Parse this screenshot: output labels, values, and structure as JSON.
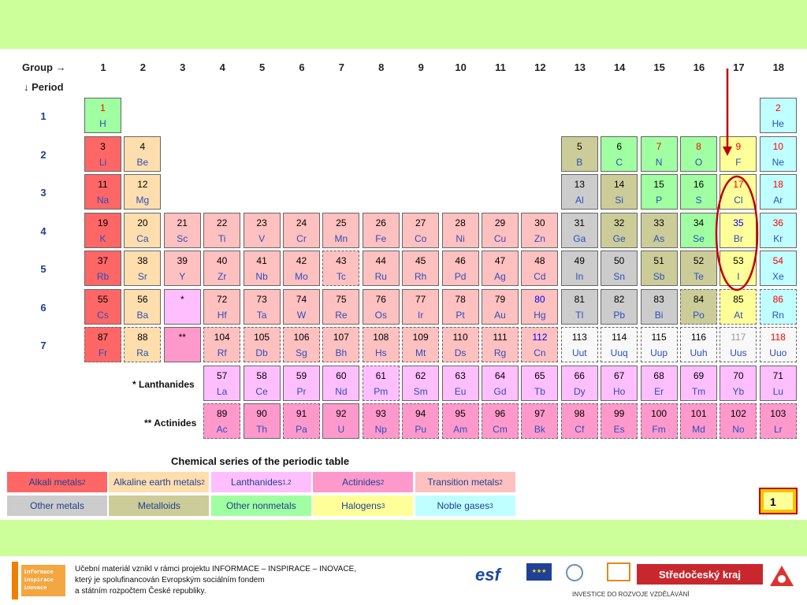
{
  "header": {
    "group_label": "Group →",
    "period_label": "↓ Period"
  },
  "groups": [
    "1",
    "2",
    "3",
    "4",
    "5",
    "6",
    "7",
    "8",
    "9",
    "10",
    "11",
    "12",
    "13",
    "14",
    "15",
    "16",
    "17",
    "18"
  ],
  "periods": [
    "1",
    "2",
    "3",
    "4",
    "5",
    "6",
    "7"
  ],
  "colors": {
    "alkali": "#ff6666",
    "alkaline": "#ffdead",
    "lanthanide": "#ffbfff",
    "actinide": "#ff99cc",
    "transition": "#ffc0c0",
    "other_metal": "#cccccc",
    "metalloid": "#cccc99",
    "nonmetal": "#a0ffa0",
    "halogen": "#ffff99",
    "noble": "#c0ffff",
    "unknown": "#f8f8f8",
    "number_red": "#ff0000",
    "number_blue": "#0000ff",
    "number_gray": "#999999",
    "number_black": "#000000",
    "top_band": "#ccff99",
    "marker": "#c00000"
  },
  "elements": [
    {
      "n": "1",
      "s": "H",
      "g": 1,
      "p": 1,
      "c": "nonmetal",
      "nc": "number_red"
    },
    {
      "n": "2",
      "s": "He",
      "g": 18,
      "p": 1,
      "c": "noble",
      "nc": "number_red"
    },
    {
      "n": "3",
      "s": "Li",
      "g": 1,
      "p": 2,
      "c": "alkali",
      "nc": "number_black"
    },
    {
      "n": "4",
      "s": "Be",
      "g": 2,
      "p": 2,
      "c": "alkaline",
      "nc": "number_black"
    },
    {
      "n": "5",
      "s": "B",
      "g": 13,
      "p": 2,
      "c": "metalloid",
      "nc": "number_black"
    },
    {
      "n": "6",
      "s": "C",
      "g": 14,
      "p": 2,
      "c": "nonmetal",
      "nc": "number_black"
    },
    {
      "n": "7",
      "s": "N",
      "g": 15,
      "p": 2,
      "c": "nonmetal",
      "nc": "number_red"
    },
    {
      "n": "8",
      "s": "O",
      "g": 16,
      "p": 2,
      "c": "nonmetal",
      "nc": "number_red"
    },
    {
      "n": "9",
      "s": "F",
      "g": 17,
      "p": 2,
      "c": "halogen",
      "nc": "number_red"
    },
    {
      "n": "10",
      "s": "Ne",
      "g": 18,
      "p": 2,
      "c": "noble",
      "nc": "number_red"
    },
    {
      "n": "11",
      "s": "Na",
      "g": 1,
      "p": 3,
      "c": "alkali",
      "nc": "number_black"
    },
    {
      "n": "12",
      "s": "Mg",
      "g": 2,
      "p": 3,
      "c": "alkaline",
      "nc": "number_black"
    },
    {
      "n": "13",
      "s": "Al",
      "g": 13,
      "p": 3,
      "c": "other_metal",
      "nc": "number_black"
    },
    {
      "n": "14",
      "s": "Si",
      "g": 14,
      "p": 3,
      "c": "metalloid",
      "nc": "number_black"
    },
    {
      "n": "15",
      "s": "P",
      "g": 15,
      "p": 3,
      "c": "nonmetal",
      "nc": "number_black"
    },
    {
      "n": "16",
      "s": "S",
      "g": 16,
      "p": 3,
      "c": "nonmetal",
      "nc": "number_black"
    },
    {
      "n": "17",
      "s": "Cl",
      "g": 17,
      "p": 3,
      "c": "halogen",
      "nc": "number_red"
    },
    {
      "n": "18",
      "s": "Ar",
      "g": 18,
      "p": 3,
      "c": "noble",
      "nc": "number_red"
    },
    {
      "n": "19",
      "s": "K",
      "g": 1,
      "p": 4,
      "c": "alkali",
      "nc": "number_black"
    },
    {
      "n": "20",
      "s": "Ca",
      "g": 2,
      "p": 4,
      "c": "alkaline",
      "nc": "number_black"
    },
    {
      "n": "21",
      "s": "Sc",
      "g": 3,
      "p": 4,
      "c": "transition",
      "nc": "number_black"
    },
    {
      "n": "22",
      "s": "Ti",
      "g": 4,
      "p": 4,
      "c": "transition",
      "nc": "number_black"
    },
    {
      "n": "23",
      "s": "V",
      "g": 5,
      "p": 4,
      "c": "transition",
      "nc": "number_black"
    },
    {
      "n": "24",
      "s": "Cr",
      "g": 6,
      "p": 4,
      "c": "transition",
      "nc": "number_black"
    },
    {
      "n": "25",
      "s": "Mn",
      "g": 7,
      "p": 4,
      "c": "transition",
      "nc": "number_black"
    },
    {
      "n": "26",
      "s": "Fe",
      "g": 8,
      "p": 4,
      "c": "transition",
      "nc": "number_black"
    },
    {
      "n": "27",
      "s": "Co",
      "g": 9,
      "p": 4,
      "c": "transition",
      "nc": "number_black"
    },
    {
      "n": "28",
      "s": "Ni",
      "g": 10,
      "p": 4,
      "c": "transition",
      "nc": "number_black"
    },
    {
      "n": "29",
      "s": "Cu",
      "g": 11,
      "p": 4,
      "c": "transition",
      "nc": "number_black"
    },
    {
      "n": "30",
      "s": "Zn",
      "g": 12,
      "p": 4,
      "c": "transition",
      "nc": "number_black"
    },
    {
      "n": "31",
      "s": "Ga",
      "g": 13,
      "p": 4,
      "c": "other_metal",
      "nc": "number_black"
    },
    {
      "n": "32",
      "s": "Ge",
      "g": 14,
      "p": 4,
      "c": "metalloid",
      "nc": "number_black"
    },
    {
      "n": "33",
      "s": "As",
      "g": 15,
      "p": 4,
      "c": "metalloid",
      "nc": "number_black"
    },
    {
      "n": "34",
      "s": "Se",
      "g": 16,
      "p": 4,
      "c": "nonmetal",
      "nc": "number_black"
    },
    {
      "n": "35",
      "s": "Br",
      "g": 17,
      "p": 4,
      "c": "halogen",
      "nc": "number_blue"
    },
    {
      "n": "36",
      "s": "Kr",
      "g": 18,
      "p": 4,
      "c": "noble",
      "nc": "number_red"
    },
    {
      "n": "37",
      "s": "Rb",
      "g": 1,
      "p": 5,
      "c": "alkali",
      "nc": "number_black"
    },
    {
      "n": "38",
      "s": "Sr",
      "g": 2,
      "p": 5,
      "c": "alkaline",
      "nc": "number_black"
    },
    {
      "n": "39",
      "s": "Y",
      "g": 3,
      "p": 5,
      "c": "transition",
      "nc": "number_black"
    },
    {
      "n": "40",
      "s": "Zr",
      "g": 4,
      "p": 5,
      "c": "transition",
      "nc": "number_black"
    },
    {
      "n": "41",
      "s": "Nb",
      "g": 5,
      "p": 5,
      "c": "transition",
      "nc": "number_black"
    },
    {
      "n": "42",
      "s": "Mo",
      "g": 6,
      "p": 5,
      "c": "transition",
      "nc": "number_black"
    },
    {
      "n": "43",
      "s": "Tc",
      "g": 7,
      "p": 5,
      "c": "transition",
      "nc": "number_black",
      "d": true
    },
    {
      "n": "44",
      "s": "Ru",
      "g": 8,
      "p": 5,
      "c": "transition",
      "nc": "number_black"
    },
    {
      "n": "45",
      "s": "Rh",
      "g": 9,
      "p": 5,
      "c": "transition",
      "nc": "number_black"
    },
    {
      "n": "46",
      "s": "Pd",
      "g": 10,
      "p": 5,
      "c": "transition",
      "nc": "number_black"
    },
    {
      "n": "47",
      "s": "Ag",
      "g": 11,
      "p": 5,
      "c": "transition",
      "nc": "number_black"
    },
    {
      "n": "48",
      "s": "Cd",
      "g": 12,
      "p": 5,
      "c": "transition",
      "nc": "number_black"
    },
    {
      "n": "49",
      "s": "In",
      "g": 13,
      "p": 5,
      "c": "other_metal",
      "nc": "number_black"
    },
    {
      "n": "50",
      "s": "Sn",
      "g": 14,
      "p": 5,
      "c": "other_metal",
      "nc": "number_black"
    },
    {
      "n": "51",
      "s": "Sb",
      "g": 15,
      "p": 5,
      "c": "metalloid",
      "nc": "number_black"
    },
    {
      "n": "52",
      "s": "Te",
      "g": 16,
      "p": 5,
      "c": "metalloid",
      "nc": "number_black"
    },
    {
      "n": "53",
      "s": "I",
      "g": 17,
      "p": 5,
      "c": "halogen",
      "nc": "number_black"
    },
    {
      "n": "54",
      "s": "Xe",
      "g": 18,
      "p": 5,
      "c": "noble",
      "nc": "number_red"
    },
    {
      "n": "55",
      "s": "Cs",
      "g": 1,
      "p": 6,
      "c": "alkali",
      "nc": "number_black"
    },
    {
      "n": "56",
      "s": "Ba",
      "g": 2,
      "p": 6,
      "c": "alkaline",
      "nc": "number_black"
    },
    {
      "n": "*",
      "s": "",
      "g": 3,
      "p": 6,
      "c": "lanthanide",
      "nc": "number_black",
      "nb": true
    },
    {
      "n": "72",
      "s": "Hf",
      "g": 4,
      "p": 6,
      "c": "transition",
      "nc": "number_black"
    },
    {
      "n": "73",
      "s": "Ta",
      "g": 5,
      "p": 6,
      "c": "transition",
      "nc": "number_black"
    },
    {
      "n": "74",
      "s": "W",
      "g": 6,
      "p": 6,
      "c": "transition",
      "nc": "number_black"
    },
    {
      "n": "75",
      "s": "Re",
      "g": 7,
      "p": 6,
      "c": "transition",
      "nc": "number_black"
    },
    {
      "n": "76",
      "s": "Os",
      "g": 8,
      "p": 6,
      "c": "transition",
      "nc": "number_black"
    },
    {
      "n": "77",
      "s": "Ir",
      "g": 9,
      "p": 6,
      "c": "transition",
      "nc": "number_black"
    },
    {
      "n": "78",
      "s": "Pt",
      "g": 10,
      "p": 6,
      "c": "transition",
      "nc": "number_black"
    },
    {
      "n": "79",
      "s": "Au",
      "g": 11,
      "p": 6,
      "c": "transition",
      "nc": "number_black"
    },
    {
      "n": "80",
      "s": "Hg",
      "g": 12,
      "p": 6,
      "c": "transition",
      "nc": "number_blue"
    },
    {
      "n": "81",
      "s": "Tl",
      "g": 13,
      "p": 6,
      "c": "other_metal",
      "nc": "number_black"
    },
    {
      "n": "82",
      "s": "Pb",
      "g": 14,
      "p": 6,
      "c": "other_metal",
      "nc": "number_black"
    },
    {
      "n": "83",
      "s": "Bi",
      "g": 15,
      "p": 6,
      "c": "other_metal",
      "nc": "number_black"
    },
    {
      "n": "84",
      "s": "Po",
      "g": 16,
      "p": 6,
      "c": "metalloid",
      "nc": "number_black",
      "d": true
    },
    {
      "n": "85",
      "s": "At",
      "g": 17,
      "p": 6,
      "c": "halogen",
      "nc": "number_black",
      "d": true
    },
    {
      "n": "86",
      "s": "Rn",
      "g": 18,
      "p": 6,
      "c": "noble",
      "nc": "number_red",
      "d": true
    },
    {
      "n": "87",
      "s": "Fr",
      "g": 1,
      "p": 7,
      "c": "alkali",
      "nc": "number_black",
      "d": true
    },
    {
      "n": "88",
      "s": "Ra",
      "g": 2,
      "p": 7,
      "c": "alkaline",
      "nc": "number_black",
      "d": true
    },
    {
      "n": "**",
      "s": "",
      "g": 3,
      "p": 7,
      "c": "actinide",
      "nc": "number_black",
      "nb": true
    },
    {
      "n": "104",
      "s": "Rf",
      "g": 4,
      "p": 7,
      "c": "transition",
      "nc": "number_black",
      "d": true
    },
    {
      "n": "105",
      "s": "Db",
      "g": 5,
      "p": 7,
      "c": "transition",
      "nc": "number_black",
      "d": true
    },
    {
      "n": "106",
      "s": "Sg",
      "g": 6,
      "p": 7,
      "c": "transition",
      "nc": "number_black",
      "d": true
    },
    {
      "n": "107",
      "s": "Bh",
      "g": 7,
      "p": 7,
      "c": "transition",
      "nc": "number_black",
      "d": true
    },
    {
      "n": "108",
      "s": "Hs",
      "g": 8,
      "p": 7,
      "c": "transition",
      "nc": "number_black",
      "d": true
    },
    {
      "n": "109",
      "s": "Mt",
      "g": 9,
      "p": 7,
      "c": "transition",
      "nc": "number_black",
      "d": true
    },
    {
      "n": "110",
      "s": "Ds",
      "g": 10,
      "p": 7,
      "c": "transition",
      "nc": "number_black",
      "d": true
    },
    {
      "n": "111",
      "s": "Rg",
      "g": 11,
      "p": 7,
      "c": "transition",
      "nc": "number_black",
      "d": true
    },
    {
      "n": "112",
      "s": "Cn",
      "g": 12,
      "p": 7,
      "c": "transition",
      "nc": "number_blue",
      "d": true
    },
    {
      "n": "113",
      "s": "Uut",
      "g": 13,
      "p": 7,
      "c": "unknown",
      "nc": "number_black",
      "d": true
    },
    {
      "n": "114",
      "s": "Uuq",
      "g": 14,
      "p": 7,
      "c": "unknown",
      "nc": "number_black",
      "d": true
    },
    {
      "n": "115",
      "s": "Uup",
      "g": 15,
      "p": 7,
      "c": "unknown",
      "nc": "number_black",
      "d": true
    },
    {
      "n": "116",
      "s": "Uuh",
      "g": 16,
      "p": 7,
      "c": "unknown",
      "nc": "number_black",
      "d": true
    },
    {
      "n": "117",
      "s": "Uus",
      "g": 17,
      "p": 7,
      "c": "unknown",
      "nc": "number_gray",
      "d": true
    },
    {
      "n": "118",
      "s": "Uuo",
      "g": 18,
      "p": 7,
      "c": "unknown",
      "nc": "number_red",
      "d": true
    },
    {
      "n": "57",
      "s": "La",
      "g": 4,
      "p": 8,
      "c": "lanthanide",
      "nc": "number_black"
    },
    {
      "n": "58",
      "s": "Ce",
      "g": 5,
      "p": 8,
      "c": "lanthanide",
      "nc": "number_black"
    },
    {
      "n": "59",
      "s": "Pr",
      "g": 6,
      "p": 8,
      "c": "lanthanide",
      "nc": "number_black"
    },
    {
      "n": "60",
      "s": "Nd",
      "g": 7,
      "p": 8,
      "c": "lanthanide",
      "nc": "number_black"
    },
    {
      "n": "61",
      "s": "Pm",
      "g": 8,
      "p": 8,
      "c": "lanthanide",
      "nc": "number_black",
      "d": true
    },
    {
      "n": "62",
      "s": "Sm",
      "g": 9,
      "p": 8,
      "c": "lanthanide",
      "nc": "number_black"
    },
    {
      "n": "63",
      "s": "Eu",
      "g": 10,
      "p": 8,
      "c": "lanthanide",
      "nc": "number_black"
    },
    {
      "n": "64",
      "s": "Gd",
      "g": 11,
      "p": 8,
      "c": "lanthanide",
      "nc": "number_black"
    },
    {
      "n": "65",
      "s": "Tb",
      "g": 12,
      "p": 8,
      "c": "lanthanide",
      "nc": "number_black"
    },
    {
      "n": "66",
      "s": "Dy",
      "g": 13,
      "p": 8,
      "c": "lanthanide",
      "nc": "number_black"
    },
    {
      "n": "67",
      "s": "Ho",
      "g": 14,
      "p": 8,
      "c": "lanthanide",
      "nc": "number_black"
    },
    {
      "n": "68",
      "s": "Er",
      "g": 15,
      "p": 8,
      "c": "lanthanide",
      "nc": "number_black"
    },
    {
      "n": "69",
      "s": "Tm",
      "g": 16,
      "p": 8,
      "c": "lanthanide",
      "nc": "number_black"
    },
    {
      "n": "70",
      "s": "Yb",
      "g": 17,
      "p": 8,
      "c": "lanthanide",
      "nc": "number_black"
    },
    {
      "n": "71",
      "s": "Lu",
      "g": 18,
      "p": 8,
      "c": "lanthanide",
      "nc": "number_black"
    },
    {
      "n": "89",
      "s": "Ac",
      "g": 4,
      "p": 9,
      "c": "actinide",
      "nc": "number_black",
      "d": true
    },
    {
      "n": "90",
      "s": "Th",
      "g": 5,
      "p": 9,
      "c": "actinide",
      "nc": "number_black"
    },
    {
      "n": "91",
      "s": "Pa",
      "g": 6,
      "p": 9,
      "c": "actinide",
      "nc": "number_black",
      "d": true
    },
    {
      "n": "92",
      "s": "U",
      "g": 7,
      "p": 9,
      "c": "actinide",
      "nc": "number_black"
    },
    {
      "n": "93",
      "s": "Np",
      "g": 8,
      "p": 9,
      "c": "actinide",
      "nc": "number_black",
      "d": true
    },
    {
      "n": "94",
      "s": "Pu",
      "g": 9,
      "p": 9,
      "c": "actinide",
      "nc": "number_black",
      "d": true
    },
    {
      "n": "95",
      "s": "Am",
      "g": 10,
      "p": 9,
      "c": "actinide",
      "nc": "number_black",
      "d": true
    },
    {
      "n": "96",
      "s": "Cm",
      "g": 11,
      "p": 9,
      "c": "actinide",
      "nc": "number_black",
      "d": true
    },
    {
      "n": "97",
      "s": "Bk",
      "g": 12,
      "p": 9,
      "c": "actinide",
      "nc": "number_black",
      "d": true
    },
    {
      "n": "98",
      "s": "Cf",
      "g": 13,
      "p": 9,
      "c": "actinide",
      "nc": "number_black",
      "d": true
    },
    {
      "n": "99",
      "s": "Es",
      "g": 14,
      "p": 9,
      "c": "actinide",
      "nc": "number_black",
      "d": true
    },
    {
      "n": "100",
      "s": "Fm",
      "g": 15,
      "p": 9,
      "c": "actinide",
      "nc": "number_black",
      "d": true
    },
    {
      "n": "101",
      "s": "Md",
      "g": 16,
      "p": 9,
      "c": "actinide",
      "nc": "number_black",
      "d": true
    },
    {
      "n": "102",
      "s": "No",
      "g": 17,
      "p": 9,
      "c": "actinide",
      "nc": "number_black",
      "d": true
    },
    {
      "n": "103",
      "s": "Lr",
      "g": 18,
      "p": 9,
      "c": "actinide",
      "nc": "number_black",
      "d": true
    }
  ],
  "series_labels": {
    "lanthanides": "* Lanthanides",
    "actinides": "** Actinides"
  },
  "legend": {
    "title": "Chemical series of the periodic table",
    "items": [
      {
        "label": "Alkali metals",
        "sup": "2",
        "c": "alkali",
        "tc": "#1f3f8f"
      },
      {
        "label": "Alkaline earth metals",
        "sup": "2",
        "c": "alkaline",
        "tc": "#1f3f8f"
      },
      {
        "label": "Lanthanides",
        "sup": "1,2",
        "c": "lanthanide",
        "tc": "#1f3f8f"
      },
      {
        "label": "Actinides",
        "sup": "2",
        "c": "actinide",
        "tc": "#1f3f8f"
      },
      {
        "label": "Transition metals",
        "sup": "2",
        "c": "transition",
        "tc": "#1f3f8f"
      },
      {
        "label": "Other metals",
        "sup": "",
        "c": "other_metal",
        "tc": "#1f3f8f"
      },
      {
        "label": "Metalloids",
        "sup": "",
        "c": "metalloid",
        "tc": "#1f3f8f"
      },
      {
        "label": "Other nonmetals",
        "sup": "",
        "c": "nonmetal",
        "tc": "#1f3f8f"
      },
      {
        "label": "Halogens",
        "sup": "3",
        "c": "halogen",
        "tc": "#1f3f8f"
      },
      {
        "label": "Noble gases",
        "sup": "3",
        "c": "noble",
        "tc": "#1f3f8f"
      }
    ]
  },
  "slide_number": "1",
  "footer": {
    "line1": "Učební materiál vznikl v rámci projektu INFORMACE – INSPIRACE – INOVACE,",
    "line2": "který je spolufinancován Evropským sociálním fondem",
    "line3": "a státním rozpočtem České republiky.",
    "logo_lines": [
      "informace",
      "inspirace",
      "inovace"
    ],
    "esf": "esf",
    "region": "Středočeský kraj",
    "invest": "INVESTICE DO ROZVOJE VZDĚLÁVÁNÍ"
  }
}
